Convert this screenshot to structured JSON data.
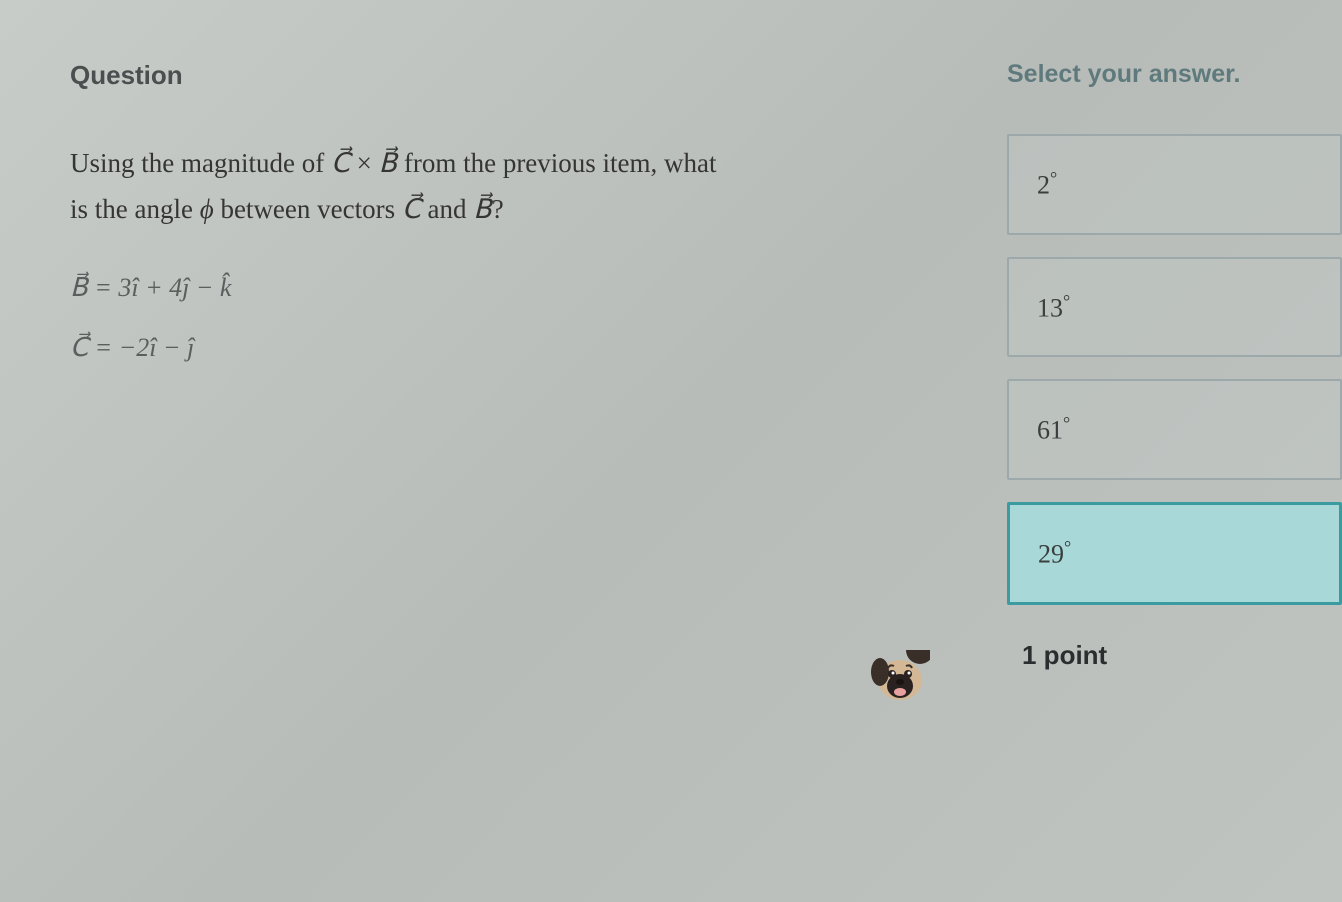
{
  "question": {
    "heading": "Question",
    "text_line1_prefix": "Using the magnitude of ",
    "text_line1_vec1": "C⃗",
    "text_line1_times": " × ",
    "text_line1_vec2": "B⃗",
    "text_line1_suffix": " from the previous item, what",
    "text_line2_prefix": "is the angle ",
    "text_line2_phi": "ϕ",
    "text_line2_mid": " between vectors ",
    "text_line2_vec1": "C⃗",
    "text_line2_and": " and ",
    "text_line2_vec2": "B⃗",
    "text_line2_suffix": "?",
    "equation1": "B⃗ = 3î + 4ĵ − k̂",
    "equation2": "C⃗ = −2î − ĵ"
  },
  "answers": {
    "heading": "Select your answer.",
    "options": [
      {
        "value": "2",
        "degree": "°",
        "selected": false
      },
      {
        "value": "13",
        "degree": "°",
        "selected": false
      },
      {
        "value": "61",
        "degree": "°",
        "selected": false
      },
      {
        "value": "29",
        "degree": "°",
        "selected": true
      }
    ],
    "points": "1 point"
  },
  "decoration": {
    "pug": "🐶"
  }
}
